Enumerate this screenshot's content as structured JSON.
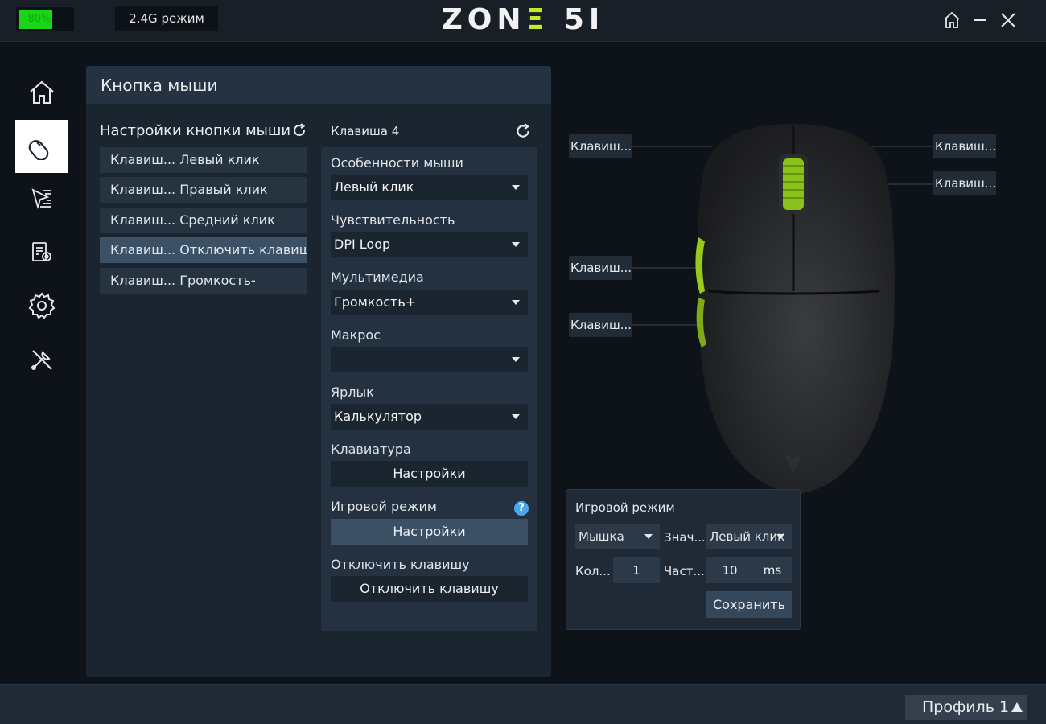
{
  "titlebar": {
    "battery_text": "80%",
    "battery_level": 0.8,
    "mode": "2.4G режим",
    "logo_left": "ZON",
    "logo_accent": "Ξ",
    "logo_right": " 5I"
  },
  "nav": [
    "home-icon",
    "mouse-icon",
    "cursor-icon",
    "macro-icon",
    "gear-icon",
    "tools-icon"
  ],
  "panel": {
    "title": "Кнопка мыши",
    "subtitle": "Настройки кнопки мыши",
    "buttons": [
      "Клавиш... Левый клик",
      "Клавиш... Правый клик",
      "Клавиш... Средний клик",
      "Клавиш... Отключить клавишу",
      "Клавиш... Громкость-"
    ]
  },
  "settings": {
    "key_title": "Клавиша 4",
    "mouse_features_label": "Особенности мыши",
    "mouse_features_value": "Левый клик",
    "sensitivity_label": "Чувствительность",
    "sensitivity_value": "DPI Loop",
    "multimedia_label": "Мультимедиа",
    "multimedia_value": "Громкость+",
    "macro_label": "Макрос",
    "macro_value": "",
    "shortcut_label": "Ярлык",
    "shortcut_value": "Калькулятор",
    "keyboard_label": "Клавиатура",
    "keyboard_button": "Настройки",
    "game_mode_label": "Игровой режим",
    "help": "?",
    "game_mode_button": "Настройки",
    "disable_label": "Отключить клавишу",
    "disable_button": "Отключить клавишу"
  },
  "mouse_tags": {
    "left_top": "Клавиш...",
    "left_side1": "Клавиш...",
    "left_side2": "Клавиш...",
    "right_top": "Клавиш...",
    "right_wheel": "Клавиш..."
  },
  "game_popup": {
    "title": "Игровой режим",
    "type_value": "Мышка",
    "value_label": "Знач...",
    "value_select": "Левый клик",
    "count_label": "Кол...",
    "count_value": "1",
    "freq_label": "Част...",
    "freq_value": "10",
    "freq_unit": "ms",
    "save": "Сохранить"
  },
  "footer": {
    "profile": "Профиль 1"
  },
  "colors": {
    "accent": "#c3e92d",
    "battery": "#19d619",
    "help": "#4aa8e8"
  }
}
